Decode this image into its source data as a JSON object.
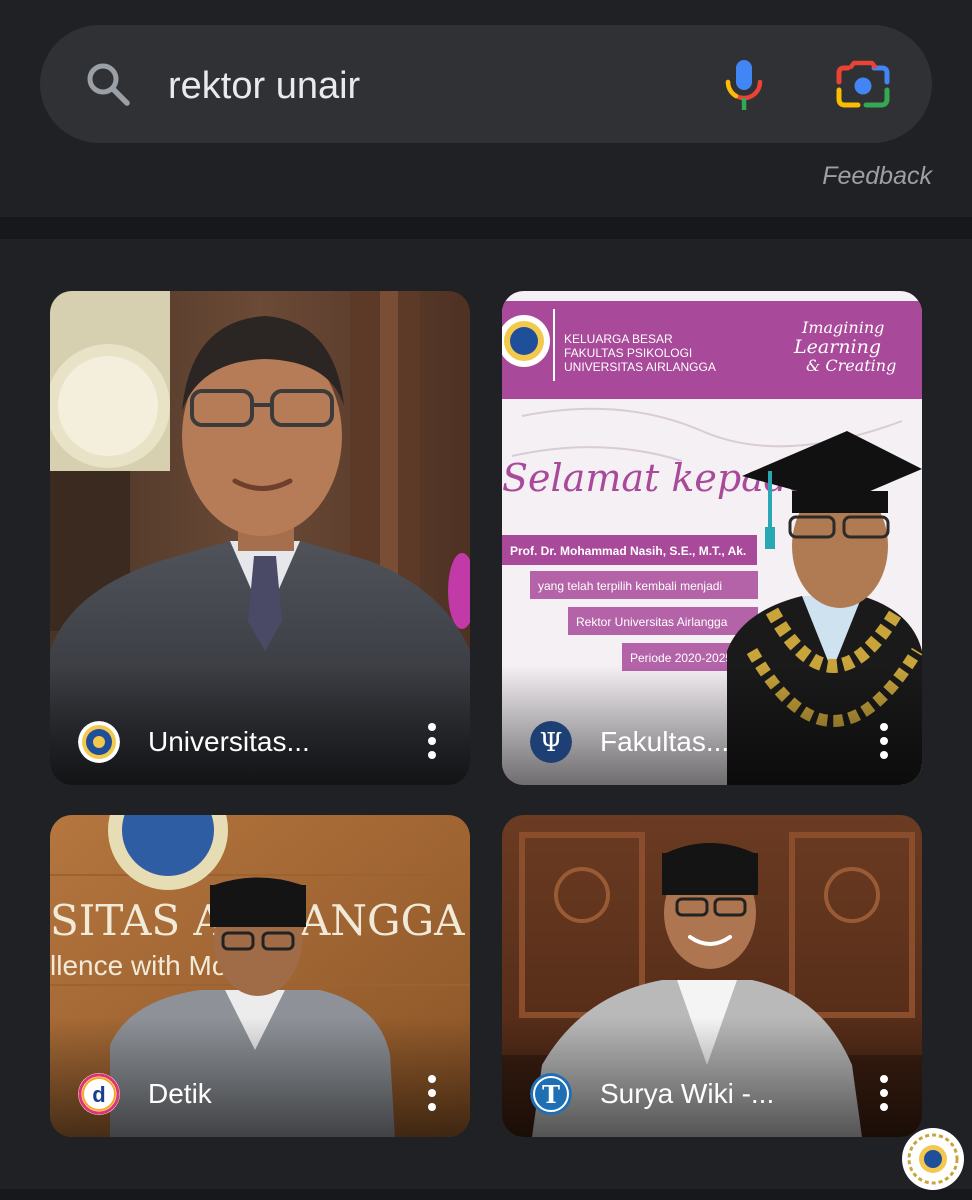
{
  "search": {
    "query": "rektor unair",
    "icons": {
      "search": "search-icon",
      "mic": "mic-icon",
      "lens": "google-lens-icon"
    }
  },
  "feedback_label": "Feedback",
  "results": [
    {
      "source": "Universitas...",
      "favicon": "unair-logo-icon",
      "image": "portrait-man-grey-suit-glasses"
    },
    {
      "source": "Fakultas...",
      "favicon": "psychology-psi-icon",
      "image": "poster-graduation-selamat-kepada",
      "poster": {
        "header": [
          "KELUARGA BESAR",
          "FAKULTAS PSIKOLOGI",
          "UNIVERSITAS AIRLANGGA"
        ],
        "tagline": [
          "Imagining",
          "Learning",
          "& Creating"
        ],
        "script": "Selamat kepada",
        "name": "Prof. Dr. Mohammad Nasih, S.E., M.T., Ak.",
        "lines": [
          "yang telah terpilih kembali menjadi",
          "Rektor Universitas Airlangga",
          "Periode 2020-2025"
        ]
      }
    },
    {
      "source": "Detik",
      "favicon": "detik-d-icon",
      "image": "man-peci-before-airlangga-sign",
      "sign": {
        "line1": "SITAS AIRLANGGA",
        "line2": "llence with Morality"
      }
    },
    {
      "source": "Surya Wiki -...",
      "favicon": "tribun-t-icon",
      "image": "man-peci-seated-wood-carving"
    }
  ],
  "colors": {
    "background": "#202124",
    "search_bar": "#303134",
    "text": "#e8eaed",
    "muted": "#9aa0a6",
    "poster_purple": "#a8499a"
  }
}
